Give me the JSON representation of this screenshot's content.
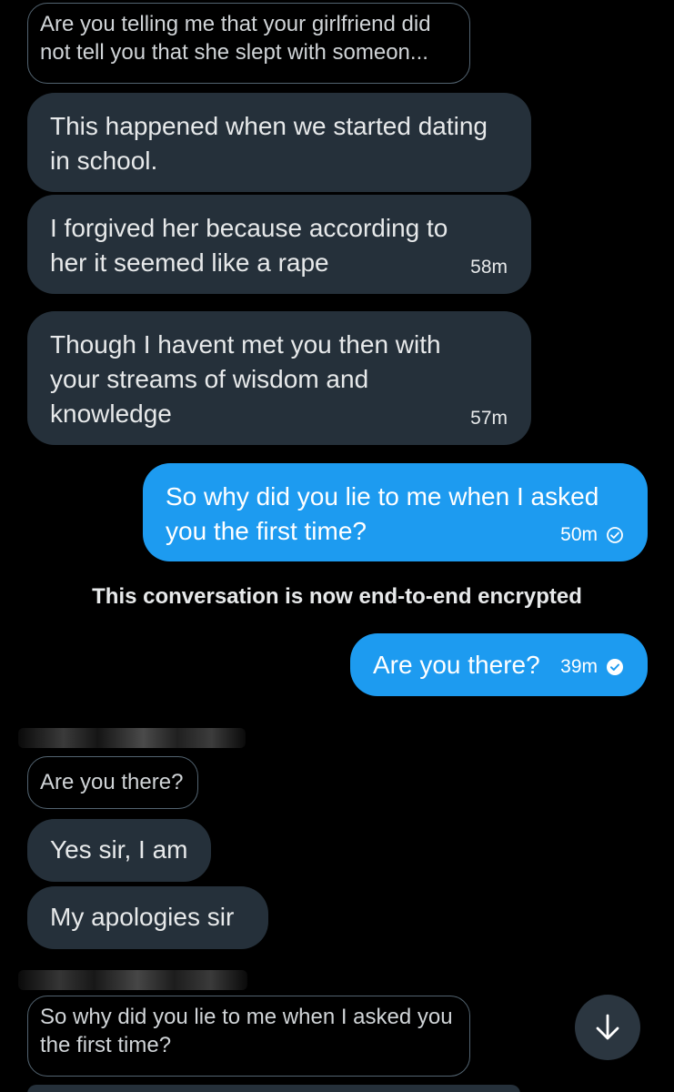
{
  "conversation": {
    "quote_top": "Are you telling me that your girlfriend did not tell you that she slept with someon...",
    "messages": [
      {
        "text": "This happened when we started dating in school.",
        "time": ""
      },
      {
        "text": "I forgived her because according to her it seemed like a rape",
        "time": "58m"
      },
      {
        "text": "Though I havent met you then with your streams of wisdom and knowledge",
        "time": "57m"
      },
      {
        "text": "So why did you lie to me when I asked you the first time?",
        "time": "50m"
      }
    ],
    "notice": "This conversation is now end-to-end encrypted",
    "out2": {
      "text": "Are you there?",
      "time": "39m"
    },
    "reply_quote_1": "Are you there?",
    "replies": [
      "Yes sir, I am",
      "My apologies sir"
    ],
    "reply_quote_2": "So why did you lie to me when I asked you the first time?"
  },
  "colors": {
    "background": "#000000",
    "incoming_bubble": "#25303a",
    "outgoing_bubble": "#1d9bf0",
    "quote_border": "#536471"
  },
  "icons": [
    "sent-check-icon",
    "read-check-icon",
    "arrow-down-icon"
  ]
}
